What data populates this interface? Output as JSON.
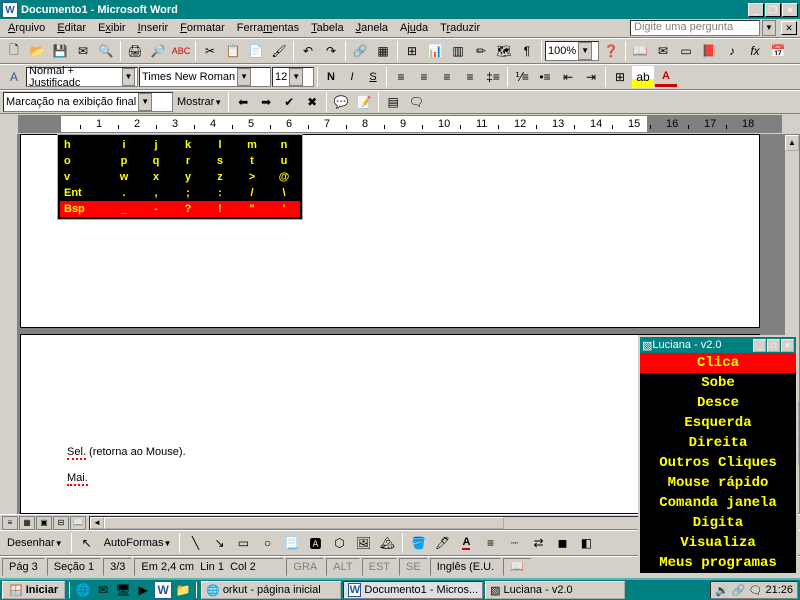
{
  "window": {
    "title": "Documento1 - Microsoft Word",
    "helpbox_placeholder": "Digite uma pergunta"
  },
  "menu": [
    "Arquivo",
    "Editar",
    "Exibir",
    "Inserir",
    "Formatar",
    "Ferramentas",
    "Tabela",
    "Janela",
    "Ajuda",
    "Traduzir"
  ],
  "formatting": {
    "style": "Normal + Justificadc",
    "font": "Times New Roman",
    "size": "12"
  },
  "zoom": "100%",
  "review": {
    "mode": "Marcação na exibição final",
    "show": "Mostrar"
  },
  "keyboard": {
    "rows": [
      [
        "h",
        "i",
        "j",
        "k",
        "l",
        "m",
        "n"
      ],
      [
        "o",
        "p",
        "q",
        "r",
        "s",
        "t",
        "u"
      ],
      [
        "v",
        "w",
        "x",
        "y",
        "z",
        ">",
        "@"
      ],
      [
        "Ent",
        ".",
        ",",
        ";",
        ":",
        "/",
        "\\"
      ],
      [
        "Bsp",
        "_",
        "-",
        "?",
        "!",
        "\"",
        "'"
      ]
    ],
    "highlight_row": 4
  },
  "document": {
    "line1_a": "Sel.",
    "line1_b": " (retorna ao Mouse).",
    "line2": "Mai."
  },
  "draw": {
    "label": "Desenhar",
    "autoshapes": "AutoFormas"
  },
  "status": {
    "page": "Pág 3",
    "section": "Seção 1",
    "pages": "3/3",
    "at": "Em 2,4 cm",
    "line": "Lin 1",
    "col": "Col 2",
    "gra": "GRA",
    "alt": "ALT",
    "est": "EST",
    "se": "SE",
    "lang": "Inglês (E.U."
  },
  "taskbar": {
    "start": "Iniciar",
    "tasks": [
      {
        "label": "orkut - página inicial",
        "active": false
      },
      {
        "label": "Documento1 - Micros...",
        "active": true
      },
      {
        "label": "Luciana - v2.0",
        "active": false
      }
    ],
    "clock": "21:26"
  },
  "luciana": {
    "title": "Luciana - v2.0",
    "items": [
      "Clica",
      "Sobe",
      "Desce",
      "Esquerda",
      "Direita",
      "Outros Cliques",
      "Mouse rápido",
      "Comanda janela",
      "Digita",
      "Visualiza",
      "Meus programas"
    ],
    "selected": 0
  },
  "ruler_numbers": [
    1,
    2,
    3,
    4,
    5,
    6,
    7,
    8,
    9,
    10,
    11,
    12,
    13,
    14,
    15,
    16,
    17,
    18
  ]
}
